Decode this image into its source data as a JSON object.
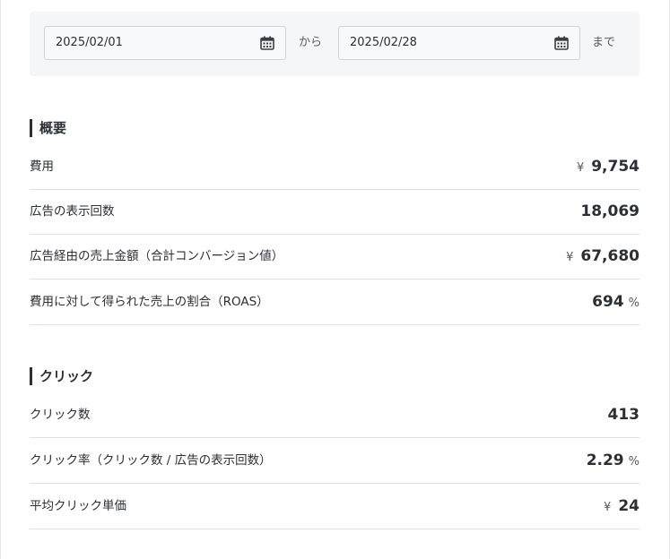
{
  "date_range": {
    "from_value": "2025/02/01",
    "to_value": "2025/02/28",
    "from_word": "から",
    "to_word": "まで",
    "icon": "calendar-icon"
  },
  "overview": {
    "title": "概要",
    "rows": [
      {
        "label": "費用",
        "prefix": "¥",
        "value": "9,754",
        "suffix": ""
      },
      {
        "label": "広告の表示回数",
        "prefix": "",
        "value": "18,069",
        "suffix": ""
      },
      {
        "label": "広告経由の売上金額（合計コンバージョン値）",
        "prefix": "¥",
        "value": "67,680",
        "suffix": ""
      },
      {
        "label": "費用に対して得られた売上の割合（ROAS）",
        "prefix": "",
        "value": "694",
        "suffix": "%"
      }
    ]
  },
  "clicks": {
    "title": "クリック",
    "rows": [
      {
        "label": "クリック数",
        "prefix": "",
        "value": "413",
        "suffix": ""
      },
      {
        "label": "クリック率（クリック数 / 広告の表示回数）",
        "prefix": "",
        "value": "2.29",
        "suffix": "%"
      },
      {
        "label": "平均クリック単価",
        "prefix": "¥",
        "value": "24",
        "suffix": ""
      }
    ]
  },
  "colors": {
    "text": "#2b2f36",
    "panel": "#f5f6f7",
    "divider": "#dee1e5"
  }
}
